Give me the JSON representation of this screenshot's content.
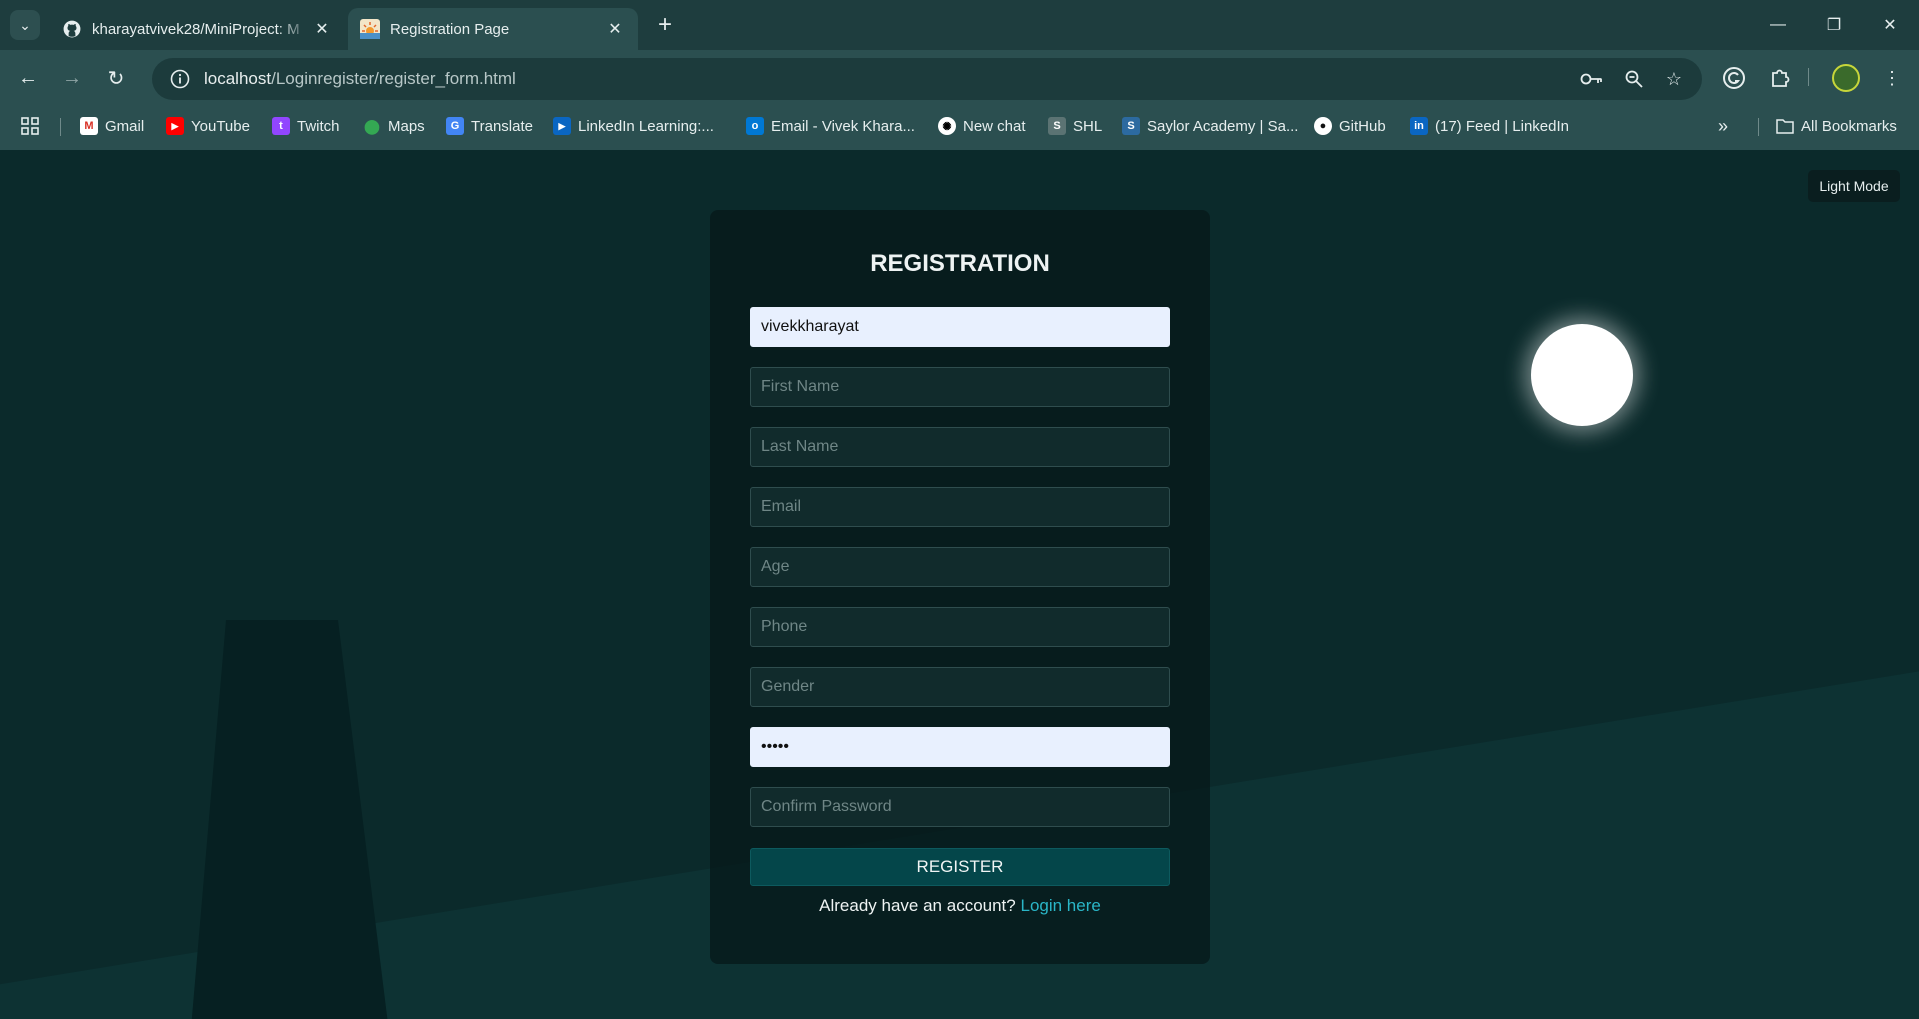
{
  "browser": {
    "tabs": [
      {
        "title": "kharayatvivek28/MiniProject: M",
        "favicon": "github-icon",
        "active": false
      },
      {
        "title": "Registration Page",
        "favicon": "sunrise-icon",
        "active": true
      }
    ],
    "url_host": "localhost",
    "url_path": "/Loginregister/register_form.html",
    "bookmarks": [
      {
        "label": "Gmail",
        "icon": "gmail-icon"
      },
      {
        "label": "YouTube",
        "icon": "youtube-icon"
      },
      {
        "label": "Twitch",
        "icon": "twitch-icon"
      },
      {
        "label": "Maps",
        "icon": "maps-icon"
      },
      {
        "label": "Translate",
        "icon": "translate-icon"
      },
      {
        "label": "LinkedIn Learning:...",
        "icon": "linkedin-learning-icon"
      },
      {
        "label": "Email - Vivek Khara...",
        "icon": "outlook-icon"
      },
      {
        "label": "New chat",
        "icon": "chatgpt-icon"
      },
      {
        "label": "SHL",
        "icon": "shl-icon"
      },
      {
        "label": "Saylor Academy | Sa...",
        "icon": "saylor-icon"
      },
      {
        "label": "GitHub",
        "icon": "github-icon"
      },
      {
        "label": "(17) Feed | LinkedIn",
        "icon": "linkedin-icon"
      }
    ],
    "all_bookmarks": "All Bookmarks"
  },
  "page": {
    "theme_toggle": "Light Mode",
    "form": {
      "title": "REGISTRATION",
      "username_value": "vivekkharayat",
      "first_name_placeholder": "First Name",
      "last_name_placeholder": "Last Name",
      "email_placeholder": "Email",
      "age_placeholder": "Age",
      "phone_placeholder": "Phone",
      "gender_placeholder": "Gender",
      "password_value": "•••••",
      "confirm_password_placeholder": "Confirm Password",
      "register_label": "REGISTER",
      "login_prompt": "Already have an account?",
      "login_link": "Login here"
    }
  },
  "colors": {
    "page_bg": "#0b2a2b",
    "accent_link": "#2ab6c7",
    "button_bg": "#04464a",
    "autofill_bg": "#e8f0fe"
  }
}
